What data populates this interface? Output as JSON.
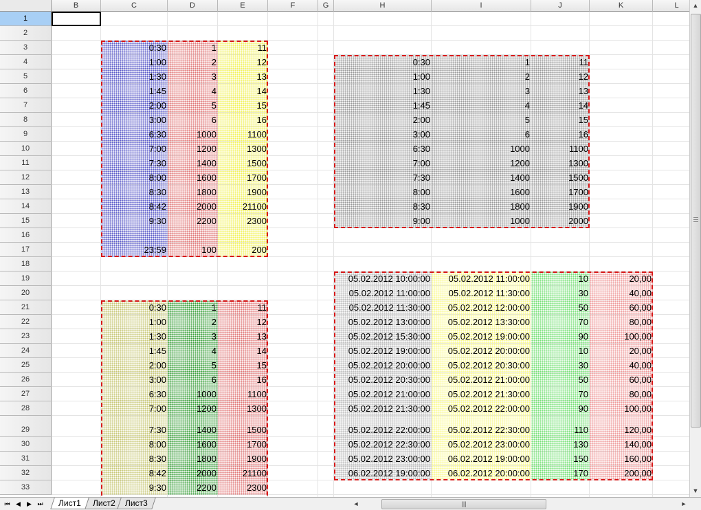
{
  "columns": [
    "B",
    "C",
    "D",
    "E",
    "F",
    "G",
    "H",
    "I",
    "J",
    "K",
    "L"
  ],
  "rows": [
    "1",
    "2",
    "3",
    "4",
    "5",
    "6",
    "7",
    "8",
    "9",
    "10",
    "11",
    "12",
    "13",
    "14",
    "15",
    "16",
    "17",
    "18",
    "19",
    "20",
    "21",
    "22",
    "23",
    "24",
    "25",
    "26",
    "27",
    "28",
    "29",
    "30",
    "31",
    "32",
    "33"
  ],
  "selected_cell": "B1",
  "block_top_left": {
    "C": [
      "0:30",
      "1:00",
      "1:30",
      "1:45",
      "2:00",
      "3:00",
      "6:30",
      "7:00",
      "7:30",
      "8:00",
      "8:30",
      "8:42",
      "9:30",
      "",
      "23:59"
    ],
    "D": [
      "1",
      "2",
      "3",
      "4",
      "5",
      "6",
      "1000",
      "1200",
      "1400",
      "1600",
      "1800",
      "2000",
      "2200",
      "",
      "100"
    ],
    "E": [
      "11",
      "12",
      "13",
      "14",
      "15",
      "16",
      "1100",
      "1300",
      "1500",
      "1700",
      "1900",
      "21100",
      "2300",
      "",
      "200"
    ]
  },
  "block_bottom_left": {
    "C": [
      "0:30",
      "1:00",
      "1:30",
      "1:45",
      "2:00",
      "3:00",
      "6:30",
      "7:00",
      "7:30",
      "8:00",
      "8:30",
      "8:42",
      "9:30"
    ],
    "D": [
      "1",
      "2",
      "3",
      "4",
      "5",
      "6",
      "1000",
      "1200",
      "1400",
      "1600",
      "1800",
      "2000",
      "2200"
    ],
    "E": [
      "11",
      "12",
      "13",
      "14",
      "15",
      "16",
      "1100",
      "1300",
      "1500",
      "1700",
      "1900",
      "21100",
      "2300"
    ]
  },
  "block_top_right": {
    "H": [
      "0:30",
      "1:00",
      "1:30",
      "1:45",
      "2:00",
      "3:00",
      "6:30",
      "7:00",
      "7:30",
      "8:00",
      "8:30",
      "9:00"
    ],
    "I": [
      "1",
      "2",
      "3",
      "4",
      "5",
      "6",
      "1000",
      "1200",
      "1400",
      "1600",
      "1800",
      "1000"
    ],
    "J": [
      "11",
      "12",
      "13",
      "14",
      "15",
      "16",
      "1100",
      "1300",
      "1500",
      "1700",
      "1900",
      "2000"
    ]
  },
  "block_bottom_right": {
    "H": [
      "05.02.2012 10:00:00",
      "05.02.2012 11:00:00",
      "05.02.2012 11:30:00",
      "05.02.2012 13:00:00",
      "05.02.2012 15:30:00",
      "05.02.2012 19:00:00",
      "05.02.2012 20:00:00",
      "05.02.2012 20:30:00",
      "05.02.2012 21:00:00",
      "05.02.2012 21:30:00",
      "05.02.2012 22:00:00",
      "05.02.2012 22:30:00",
      "05.02.2012 23:00:00",
      "06.02.2012 19:00:00"
    ],
    "I": [
      "05.02.2012 11:00:00",
      "05.02.2012 11:30:00",
      "05.02.2012 12:00:00",
      "05.02.2012 13:30:00",
      "05.02.2012 19:00:00",
      "05.02.2012 20:00:00",
      "05.02.2012 20:30:00",
      "05.02.2012 21:00:00",
      "05.02.2012 21:30:00",
      "05.02.2012 22:00:00",
      "05.02.2012 22:30:00",
      "05.02.2012 23:00:00",
      "06.02.2012 19:00:00",
      "06.02.2012 20:00:00"
    ],
    "J": [
      "10",
      "30",
      "50",
      "70",
      "90",
      "10",
      "30",
      "50",
      "70",
      "90",
      "110",
      "130",
      "150",
      "170"
    ],
    "K": [
      "20,00",
      "40,00",
      "60,00",
      "80,00",
      "100,00",
      "20,00",
      "40,00",
      "60,00",
      "80,00",
      "100,00",
      "120,00",
      "140,00",
      "160,00",
      "200,00"
    ]
  },
  "sheet_tabs": [
    "Лист1",
    "Лист2",
    "Лист3"
  ],
  "active_tab": "Лист1",
  "nav_icons": [
    "first-sheet-icon",
    "prev-sheet-icon",
    "next-sheet-icon",
    "last-sheet-icon"
  ],
  "fill_colors": {
    "blue": "#5a5ac8",
    "pink": "#e07878",
    "yellow": "#f2f25a",
    "gray": "#9a9a9a",
    "olive": "#c8c878",
    "green": "#3aa03a",
    "light_green": "#78e078",
    "light_gray": "#bdbdbd",
    "light_yellow": "#fafa8c",
    "light_pink": "#ee9a9a",
    "border_red": "#d81818"
  }
}
